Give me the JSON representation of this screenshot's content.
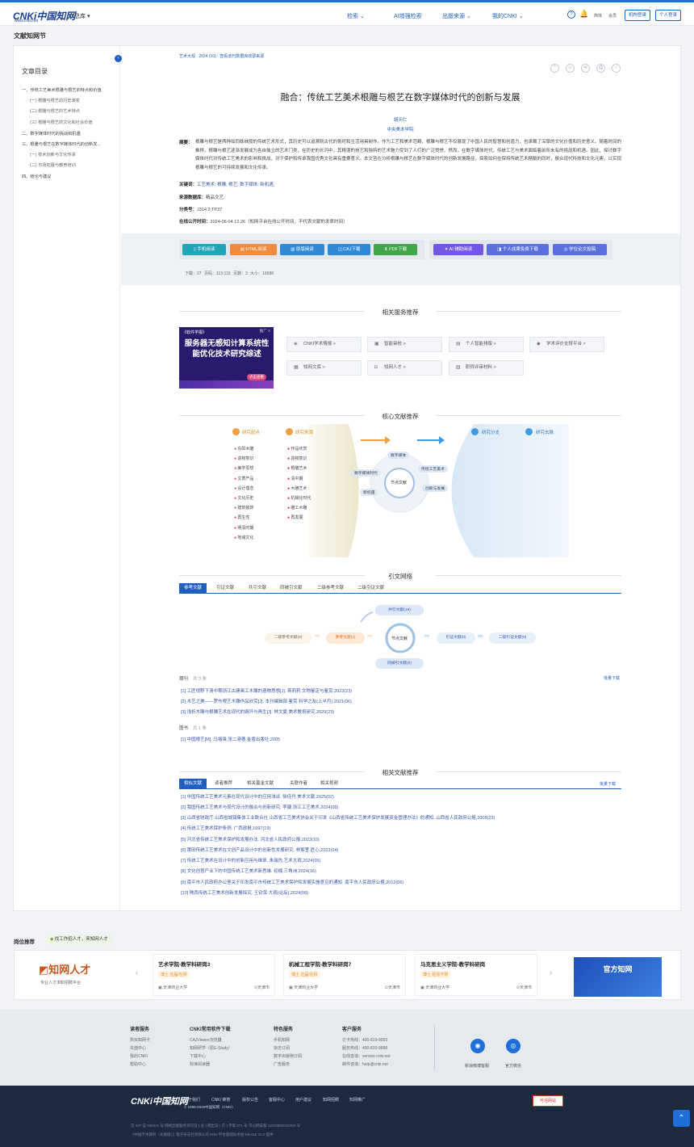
{
  "header": {
    "logo_text": "CNKi中国知网",
    "logo_url_text": "www.cnki.net",
    "zongku": "总库",
    "nav": [
      "检索",
      "AI增强检索",
      "出版来源",
      "我的CNKI"
    ],
    "lang_link": "简体",
    "member_link": "会员",
    "org_login": "机构登录",
    "personal_login": "个人登录"
  },
  "page_title": "文献知网节",
  "toc": {
    "title": "文章目录",
    "items": [
      {
        "label": "一、传统工艺美术根雕与根艺的特点和价值",
        "sub": false
      },
      {
        "label": "(一) 根雕与根艺的历史演变",
        "sub": true
      },
      {
        "label": "(二) 根雕与根艺的艺术特点",
        "sub": true
      },
      {
        "label": "(三) 根雕与根艺的文化和社会价值",
        "sub": true
      },
      {
        "label": "二、数字媒体时代的挑战和机遇",
        "sub": false
      },
      {
        "label": "三、根雕与根艺在数字媒体时代的创新发...",
        "sub": false
      },
      {
        "label": "(一) 技术创新与文化传承",
        "sub": true
      },
      {
        "label": "(二) 市场拓展与教育培训",
        "sub": true
      },
      {
        "label": "四、结论与建议",
        "sub": false
      }
    ]
  },
  "article": {
    "breadcrumb": "艺术大观 · 2024 (10) · 查看该刊数据库收录来源",
    "title": "融合：传统工艺美术根雕与根艺在数字媒体时代的创新与发展",
    "author": "胡天仁",
    "institution": "中央美术学院",
    "abstract_label": "摘要：",
    "abstract": "根雕与根艺是两种如同姊妹般的传统艺术形式，其历史可以追溯到古代的祭祀和生活用具制作。作为工艺和美术范畴，根雕与根艺不仅展现了中国人民的智慧和创造力，也承载了深厚的文化价值和历史意义。随着时间的推移，根雕与根艺逐渐发展成为各自独立的艺术门类，在历史的长河中，其精湛的技艺和独特的艺术魅力受到了人们的广泛赞誉。然而，在数字媒体时代，传统工艺与美术面临着前所未有的挑战和机遇。因此，探讨数字媒体时代对传统工艺美术的影响和挑战，对于保护和传承我国优秀文化具有重要意义。本文旨在分析根雕与根艺在数字媒体时代的创新发展路径，探索如何在保持传统艺术精髓的同时，融合现代科技和文化元素，以实现根雕与根艺的可持续发展和文化传承。",
    "keywords_label": "关键词：",
    "keywords": "工艺美术;  根雕;  根艺;  数字媒体;  新机遇;",
    "db_label": "来源数据库：",
    "db": "精品文艺",
    "class_label": "分类号：",
    "class": "J314.2;TP37",
    "pubtime_label": "在线公开时间：",
    "pubtime": "2024-06-04 12:26（知网平台在线公开时间，不代表文献的发表时间）"
  },
  "read_buttons": [
    {
      "label": "手机阅读",
      "color": "#1fa4b8"
    },
    {
      "label": "HTML阅读",
      "color": "#f08a3c"
    },
    {
      "label": "原版阅读",
      "color": "#2f88d8"
    },
    {
      "label": "CAJ下载",
      "color": "#2f88d8"
    },
    {
      "label": "PDF下载",
      "color": "#3fa64a"
    },
    {
      "label": "AI 辅助阅读",
      "color": "#7257e6"
    },
    {
      "label": "个人成果免费下载",
      "color": "#5a6fe0"
    },
    {
      "label": "学位论文投稿",
      "color": "#5a6fe0"
    }
  ],
  "stats": "下载：27    页码：113-115    页数：3    大小：1658K",
  "services": {
    "title": "相关服务推荐",
    "promo_title": "服务器无感知计算系统性能优化技术研究综述",
    "promo_tag": "《软件学报》",
    "promo_ad": "推广 X",
    "promo_btn": "点击查看",
    "items": [
      "CNKI学术情报 >",
      "智能审校 >",
      "个人智能排版 >",
      "学术评价支撑平台 >",
      "知网文库 >",
      "知网人才 >",
      "职称评审材料 >"
    ]
  },
  "core": {
    "title": "核心文献推荐",
    "left_head1": "研究起点",
    "left_head2": "研究来源",
    "right_head1": "研究分支",
    "right_head2": "研究去脉",
    "left_list1": [
      "东阳木雕",
      "造物意识",
      "美学思想",
      "文质产品",
      "设计理念",
      "文化历史",
      "建筑装饰",
      "再生性",
      "明清时期",
      "地域文化"
    ],
    "left_list2": [
      "作品欣赏",
      "造物意识",
      "根雕艺术",
      "清中期",
      "木雕艺术",
      "机械化时代",
      "雕工木雕",
      "再发展"
    ],
    "center": "节点文献",
    "orbit": [
      "数字媒体",
      "数字媒体时代",
      "传统工艺美术",
      "新机遇",
      "创新与发展"
    ]
  },
  "citation": {
    "title": "引文网络",
    "tabs": [
      "参考文献",
      "引证文献",
      "共引文献",
      "同被引文献",
      "二级参考文献",
      "二级引证文献"
    ],
    "nodes": {
      "co_cite": "共引文献(19)",
      "second_ref": "二级参考文献(9)",
      "ref": "参考文献(4)",
      "center": "节点文献",
      "cited": "引证文献(0)",
      "second_cited": "二级引证文献(0)",
      "same_cited": "同被引文献(0)"
    },
    "journal_label": "期刊",
    "journal_count": "共 3 条",
    "batch_download": "批量下载",
    "journal_refs": [
      "[1] 工匠视野下清中期浙江古建画工木雕的造物思想[J]. 蒋莉莉.文物鉴定与鉴赏,2023(23)",
      "[2] 木艺之美——罗东根艺木雕作品欣赏[J]. 本刊编辑部.鉴赏.科学之友(上半月),2021(06)",
      "[3] 浅析木雕与根雕艺术在现代的毁坏与再生[J]. 林文夏.美术教育研究,2020(23)"
    ],
    "book_label": "图书",
    "book_count": "共 1 条",
    "book_refs": [
      "[1] 中国根艺[M]. 马堵锋,张二港著.金盾出版社.2005"
    ]
  },
  "related": {
    "title": "相关文献推荐",
    "tabs": [
      "相似文献",
      "读者推荐",
      "相关基金文献",
      "关联作者",
      "相关视频"
    ],
    "batch_download": "批量下载",
    "refs": [
      "[1] 中国传统工艺美术元素在现代设计中的应用浅谈. 徐佳丹.美术文献,2025(02)",
      "[2] 我国传统工艺美术与现代设计的融合与创新研究. 李婕.浙江工艺美术,2024(08)",
      "[3] 山西省财政厅 山西省城镇集体工业联合社 山西省工艺美术协会关于印发《山西省传统工艺美术保护发展资金管理办法》的通知. 山西省人民政府公报,2008(23)",
      "[4] 传统工艺美术保护条例. 广西政报,1997(19)",
      "[5] 河北省传统工艺美术保护和发展办法. 河北省人民政府公报,2023(10)",
      "[6] 莆田传统工艺美术在文创产品设计中的创新性发展研究. 林紫萱.匠心,2023(04)",
      "[7] 传统工艺美术在设计中的创新应用与继承. 朱瑞先.艺术大观,2024(05)",
      "[8] 文化创意产业下的中国传统工艺美术新思维. 初楠.三角洲,2024(16)",
      "[9] 南平市人民政府办公室关于印发南平市传统工艺美术保护和发展实施意见的通知. 南平市人民政府公报,2012(06)",
      "[10] 陕西传统工艺美术创新发展探究. 王钦荣.大观(论坛),2024(08)"
    ]
  },
  "jobs": {
    "title": "岗位推荐",
    "badge": "找工作招人才，来知网人才",
    "brand": "知网人才",
    "brand_sub": "专业人才求职招聘平台",
    "cards": [
      {
        "title": "艺术学院-教学科研岗3",
        "tag": "博士  应届/在校",
        "company": "天津商业大学",
        "city": "天津市"
      },
      {
        "title": "机械工程学院-教学科研岗7",
        "tag": "博士  应届/在校",
        "company": "天津商业大学",
        "city": "天津市"
      },
      {
        "title": "马克思主义学院-教学科研岗",
        "tag": "博士  经验不限",
        "company": "天津商业大学",
        "city": "天津市"
      }
    ],
    "banner": "官方知网"
  },
  "footer": {
    "cols": [
      {
        "title": "读者服务",
        "items": [
          "购买知网卡",
          "充值中心",
          "我的CNKI",
          "帮助中心"
        ]
      },
      {
        "title": "CNKI常用软件下载",
        "items": [
          "CAJViewer浏览器",
          "知网研学（原E-Study）",
          "下载中心",
          "标准阅读器"
        ]
      },
      {
        "title": "特色服务",
        "items": [
          "手机知网",
          "杂志订阅",
          "数字出版物订阅",
          "广告服务"
        ]
      },
      {
        "title": "客户服务",
        "items": [
          "订卡热线：400-819-9993",
          "服务热线：400-810-9888",
          "在线咨询：service.cnki.net",
          "邮件咨询：help@cnki.net"
        ]
      }
    ],
    "weibo": "新浪微博客服",
    "wechat": "官方微信"
  },
  "bottom": {
    "links": [
      "关于我们",
      "CNKI 荣誉",
      "版权公告",
      "客服中心",
      "用户建议",
      "知网招聘",
      "知网推广"
    ],
    "copyright": "© 1998-2025中国知网（CNKI）",
    "icp": "京 ICP 证 040431 号  网络出版服务许可证 ( 总 ) 网出证 ( 京 ) 字第 271 号  京公网安备 11010802020460 号",
    "corp": "《中国学术期刊（光盘版）》电子杂志社有限公司  KDN 平台基础技术由 KBASE 11.0 提供",
    "badge": "可信网站"
  }
}
